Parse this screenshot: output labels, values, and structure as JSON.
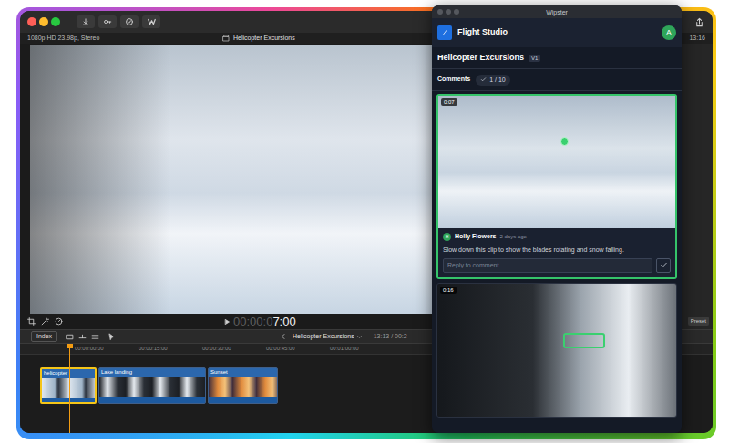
{
  "editor": {
    "format": "1080p HD 23.98p, Stereo",
    "title": "Helicopter Excursions",
    "duration": "13:16",
    "timecode": {
      "dim": "00:00:0",
      "bright": "7:00"
    },
    "inspector_button": "Preset",
    "timeline": {
      "index_button": "Index",
      "project": "Helicopter Excursions",
      "position": "13:13 / 00:2",
      "ruler": [
        "00:00:00:00",
        "00:00:15:00",
        "00:00:30:00",
        "00:00:45:00",
        "00:01:00:00"
      ],
      "clips": [
        {
          "name": "helicopter",
          "selected": true
        },
        {
          "name": "Lake landing",
          "selected": false
        },
        {
          "name": "Sunset",
          "selected": false
        }
      ]
    }
  },
  "review_panel": {
    "window": {
      "title": "Wipster"
    },
    "workspace": "Flight Studio",
    "user_initial": "A",
    "project": "Helicopter Excursions",
    "version": "V1",
    "comments_label": "Comments",
    "resolved": "1 / 10",
    "comments": [
      {
        "time": "0:07",
        "selected": true,
        "kind": "point",
        "author": "Holly Flowers",
        "author_initial": "H",
        "age": "2 days ago",
        "text": "Slow down this clip to show the blades rotating and snow falling.",
        "reply_placeholder": "Reply to comment"
      },
      {
        "time": "0:16",
        "selected": false,
        "kind": "box"
      }
    ]
  }
}
